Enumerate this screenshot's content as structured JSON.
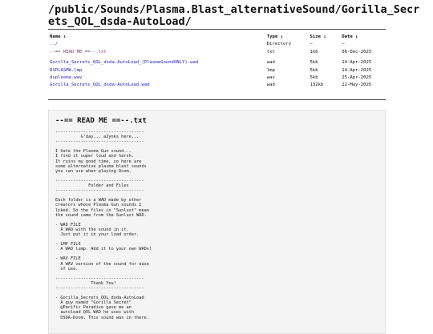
{
  "title": "/public/Sounds/Plasma.Blast_alternativeSound/Gorilla_Secrets_QOL_dsda-AutoLoad/",
  "columns": {
    "name": "Name ↓",
    "type": "Type ↓",
    "size": "Size ↓",
    "date": "Date ↓"
  },
  "rows": [
    {
      "name": "../",
      "type": "Directory",
      "size": "–",
      "date": "–"
    },
    {
      "name": "--== READ ME ==--.txt",
      "type": "txt",
      "size": "1kb",
      "date": "06-Dec-2025"
    },
    {
      "name": "Gorilla_Secrets_QOL_dsda-AutoLoad_(PlasmaSoundONLY).wad",
      "type": "wad",
      "size": "5kb",
      "date": "14-Apr-2025"
    },
    {
      "name": "DSPLASMA.lmp",
      "type": "lmp",
      "size": "5kb",
      "date": "14-Apr-2025"
    },
    {
      "name": "dsplasma.wav",
      "type": "wav",
      "size": "5kb",
      "date": "25-Apr-2025"
    },
    {
      "name": "Gorilla_Secrets_QOL_dsda-AutoLoad.wad",
      "type": "wad",
      "size": "132kb",
      "date": "22-May-2025"
    }
  ],
  "readme": {
    "heading": "--== READ ME ==--.txt",
    "body": "-----------------------------------\n          G'day... aJynks here...\n-----------------------------------\n\nI hate the Plasma Gun sound...\nI find it super loud and harsh.\nIt ruins my good time, so here are\nsome alternative plasma blast sounds\nyou can use when playing Doom.\n\n-----------------------------------\n             Folder and Files\n-----------------------------------\n\nEach folder is a WAD made by other\ncreators whose Plasma Gun sounds I\nliked. So the files in \"Sunlust\" mean\nthe sound came from the Sunlust WAD.\n\n- WAD FILE\n  A WAD with the sound in it.\n  Just put it in your load order.\n\n- LMP FILE\n  A WAD lump. Add it to your own WADs!\n\n- WAV FILE\n  A WAV version of the sound for ease\n  of use.\n\n-----------------------------------\n              Thank You!\n-----------------------------------\n\n- Gorilla_Secrets_QOL_dsda-AutoLoad\n  A guy named \"Gorilla Secret\"\n  @Pacific Paradise gave me an\n  autoload QOL WAD he uses with\n  DSDA-Doom. This sound was in there."
  }
}
